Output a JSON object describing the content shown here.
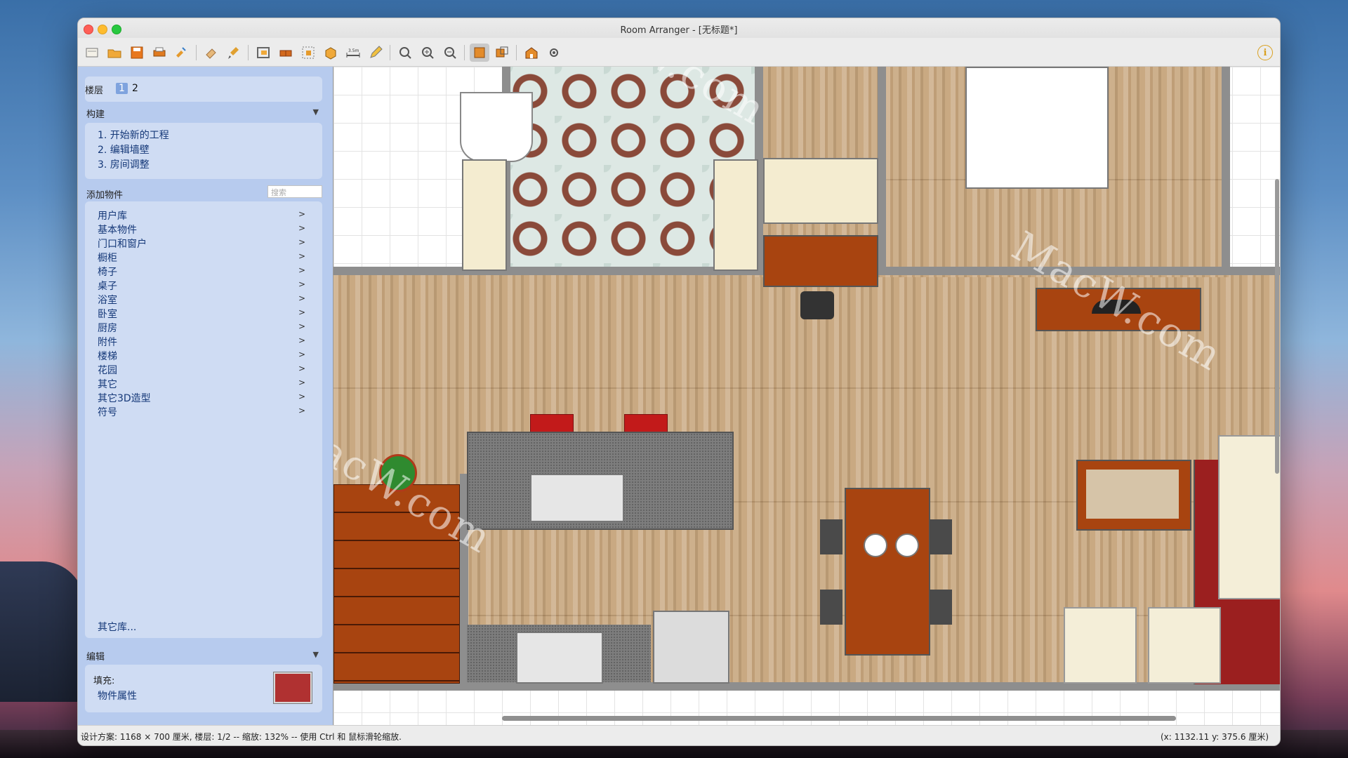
{
  "window": {
    "title": "Room Arranger - [无标题*]"
  },
  "toolbar": {
    "icons": [
      "new-file-icon",
      "open-folder-icon",
      "save-icon",
      "print-icon",
      "wizard-icon",
      "eraser-icon",
      "brush-icon",
      "add-room-icon",
      "add-wall-icon",
      "select-area-icon",
      "3d-objects-icon",
      "measure-icon",
      "pencil-icon",
      "zoom-fit-icon",
      "zoom-in-icon",
      "zoom-out-icon",
      "2d-view-icon",
      "3d-view-icon",
      "house-icon",
      "settings-icon"
    ],
    "measure_label": "3.5m",
    "info_label": "i"
  },
  "sidebar": {
    "floors": {
      "label": "楼层",
      "items": [
        "1",
        "2"
      ],
      "selected": "1"
    },
    "build": {
      "header": "构建",
      "items": [
        "1. 开始新的工程",
        "2. 编辑墙壁",
        "3. 房间调整"
      ]
    },
    "add_objects": {
      "header": "添加物件",
      "search_placeholder": "搜索",
      "categories": [
        "用户库",
        "基本物件",
        "门口和窗户",
        "橱柜",
        "椅子",
        "桌子",
        "浴室",
        "卧室",
        "厨房",
        "附件",
        "楼梯",
        "花园",
        "其它",
        "其它3D造型",
        "符号"
      ],
      "more_libs": "其它库..."
    },
    "edit": {
      "header": "编辑",
      "fill_label": "填充:",
      "properties_link": "物件属性",
      "fill_color": "#b03131"
    }
  },
  "status": {
    "left": "设计方案: 1168 × 700 厘米, 楼层: 1/2 -- 缩放: 132% -- 使用 Ctrl 和 鼠标滑轮缩放.",
    "right": "(x: 1132.11 y: 375.6 厘米)"
  },
  "watermark": "MacW.com",
  "colors": {
    "floor_wood": "#c9a982",
    "wall": "#8e8e8e",
    "furniture_wood": "#a84410",
    "carpet": "#9b1f1f",
    "countertop": "#7d7d7d"
  }
}
